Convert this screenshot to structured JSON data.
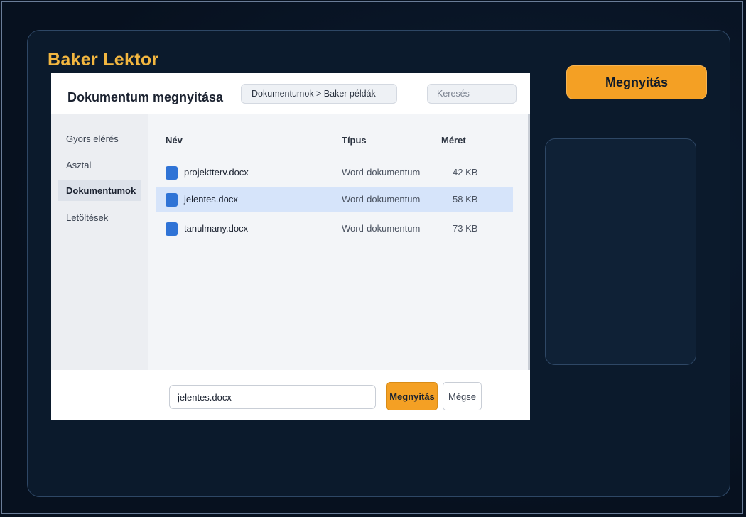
{
  "app": {
    "title": "Baker Lektor",
    "open_label": "Megnyitás"
  },
  "dialog": {
    "title": "Dokumentum megnyitása",
    "breadcrumb": "Dokumentumok > Baker példák",
    "search_placeholder": "Keresés",
    "nav": [
      {
        "label": "Gyors elérés",
        "active": false
      },
      {
        "label": "Asztal",
        "active": false
      },
      {
        "label": "Dokumentumok",
        "active": true
      },
      {
        "label": "Letöltések",
        "active": false
      }
    ],
    "columns": {
      "name": "Név",
      "type": "Típus",
      "size": "Méret"
    },
    "files": [
      {
        "name": "projektterv.docx",
        "type": "Word-dokumentum",
        "size": "42 KB",
        "icon": "word-document-icon",
        "selected": false
      },
      {
        "name": "jelentes.docx",
        "type": "Word-dokumentum",
        "size": "58 KB",
        "icon": "word-document-icon",
        "selected": true
      },
      {
        "name": "tanulmany.docx",
        "type": "Word-dokumentum",
        "size": "73 KB",
        "icon": "word-document-icon",
        "selected": false
      }
    ],
    "filename_value": "jelentes.docx",
    "open_label": "Megnyitás",
    "cancel_label": "Mégse"
  },
  "colors": {
    "accent": "#f4a024",
    "title": "#f2b640",
    "background": "#07111f",
    "selection": "#d6e4fa",
    "file_icon": "#2f73d6"
  }
}
